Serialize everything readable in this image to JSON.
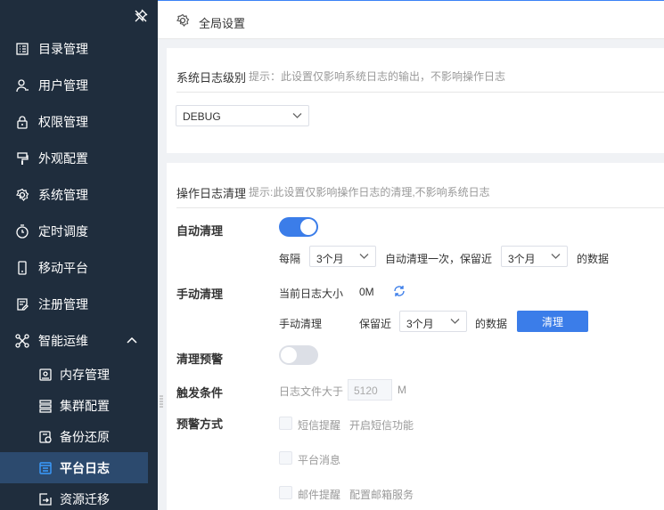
{
  "sidebar": {
    "items": [
      {
        "label": "目录管理",
        "icon": "list-icon"
      },
      {
        "label": "用户管理",
        "icon": "user-icon"
      },
      {
        "label": "权限管理",
        "icon": "lock-icon"
      },
      {
        "label": "外观配置",
        "icon": "paint-icon"
      },
      {
        "label": "系统管理",
        "icon": "gear-icon"
      },
      {
        "label": "定时调度",
        "icon": "clock-icon"
      },
      {
        "label": "移动平台",
        "icon": "mobile-icon"
      },
      {
        "label": "注册管理",
        "icon": "register-icon"
      },
      {
        "label": "智能运维",
        "icon": "nodes-icon"
      }
    ],
    "sub_items": [
      {
        "label": "内存管理",
        "icon": "memory-icon"
      },
      {
        "label": "集群配置",
        "icon": "server-icon"
      },
      {
        "label": "备份还原",
        "icon": "backup-icon"
      },
      {
        "label": "平台日志",
        "icon": "log-icon",
        "active": true
      },
      {
        "label": "资源迁移",
        "icon": "migrate-icon"
      }
    ]
  },
  "header": {
    "title": "全局设置"
  },
  "syslog": {
    "title": "系统日志级别",
    "hint": "提示：此设置仅影响系统日志的输出，不影响操作日志",
    "level": "DEBUG"
  },
  "oplog": {
    "title": "操作日志清理",
    "hint": "提示:此设置仅影响操作日志的清理,不影响系统日志",
    "auto_clean": {
      "label": "自动清理",
      "enabled": true,
      "every_label": "每隔",
      "interval": "3个月",
      "mid_text": "自动清理一次，保留近",
      "keep": "3个月",
      "suffix": "的数据"
    },
    "manual_clean": {
      "label": "手动清理",
      "size_label": "当前日志大小",
      "size": "0M",
      "action_label": "手动清理",
      "keep_label": "保留近",
      "keep": "3个月",
      "suffix": "的数据",
      "button": "清理"
    },
    "warning": {
      "label": "清理预警",
      "enabled": false
    },
    "trigger": {
      "label": "触发条件",
      "text": "日志文件大于",
      "value": "5120",
      "unit": "M"
    },
    "method": {
      "label": "预警方式",
      "options": [
        {
          "label": "短信提醒",
          "link": "开启短信功能"
        },
        {
          "label": "平台消息",
          "link": ""
        },
        {
          "label": "邮件提醒",
          "link": "配置邮箱服务"
        }
      ]
    }
  },
  "colors": {
    "sidebar_bg": "#1f2d3d",
    "accent": "#3b7de9",
    "active_item": "#2c4a6e"
  }
}
